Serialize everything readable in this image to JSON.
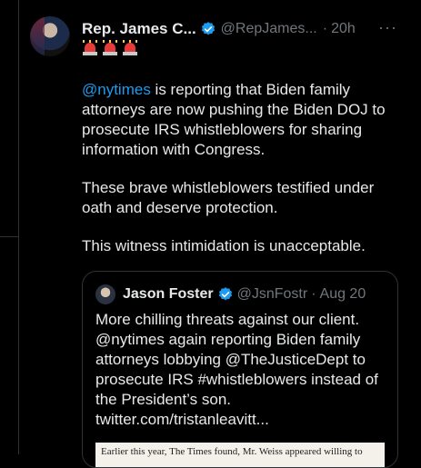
{
  "author": {
    "name": "Rep. James C...",
    "handle": "@RepJames...",
    "separator": "·",
    "time": "20h",
    "more_label": "···",
    "emoji_line": [
      "siren",
      "siren",
      "siren"
    ]
  },
  "tweet": {
    "mention": "@nytimes",
    "para1_rest": " is reporting that Biden family attorneys are now pushing the Biden DOJ to prosecute IRS whistleblowers for sharing information with Congress.",
    "para2": "These brave whistleblowers testified under oath and deserve protection.",
    "para3": "This witness intimidation is unacceptable."
  },
  "quote": {
    "name": "Jason Foster",
    "handle": "@JsnFostr",
    "separator": "·",
    "date": "Aug 20",
    "text": "More chilling threats against our client. @nytimes again reporting Biden family attorneys lobbying @TheJusticeDept to prosecute IRS #whistleblowers instead of the President’s son. twitter.com/tristanleavitt...",
    "image_text": "Earlier this year, The Times found, Mr. Weiss appeared willing to"
  },
  "colors": {
    "background": "#000000",
    "link": "#1d9bf0",
    "muted": "#71767b",
    "verified": "#1d9bf0",
    "siren": "#e63b3b"
  }
}
